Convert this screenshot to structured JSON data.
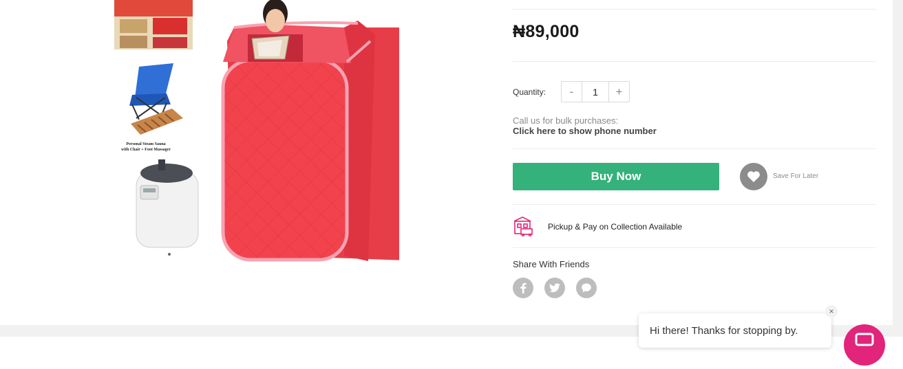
{
  "product": {
    "price": "₦89,000",
    "image_caption_line1": "Personal Steam Sauna",
    "image_caption_line2": "with Chair + Foot Massager"
  },
  "quantity": {
    "label": "Quantity:",
    "decrement": "-",
    "value": "1",
    "increment": "+"
  },
  "bulk": {
    "text": "Call us for bulk purchases:",
    "link": "Click here to show phone number"
  },
  "actions": {
    "buy_now": "Buy Now",
    "save_for_later": "Save For Later"
  },
  "delivery": {
    "pickup_text": "Pickup & Pay on Collection Available"
  },
  "share": {
    "title": "Share With Friends",
    "icons": [
      "facebook-icon",
      "twitter-icon",
      "chat-icon"
    ]
  },
  "chat": {
    "close": "×",
    "greeting": "Hi there! Thanks for stopping by."
  },
  "colors": {
    "buy_button": "#35b17b",
    "brand_pink": "#e2247a",
    "tent_red": "#f2434d",
    "tent_trim": "#f7a3b2"
  }
}
